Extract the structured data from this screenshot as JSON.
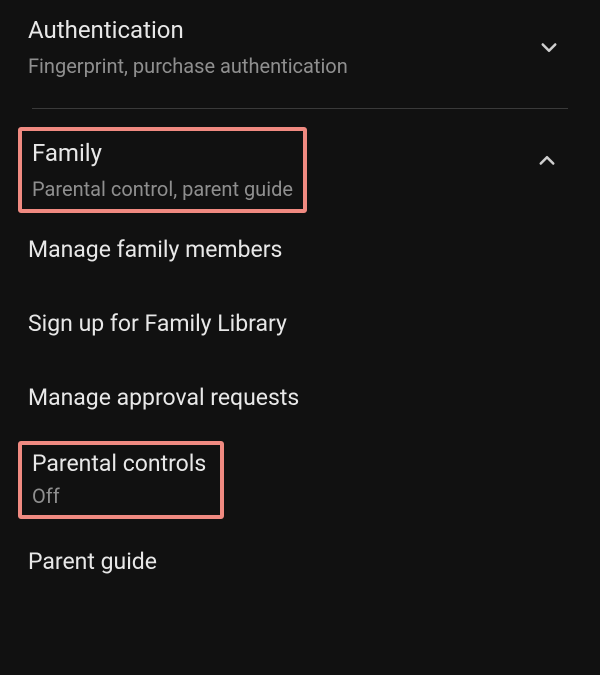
{
  "authentication": {
    "title": "Authentication",
    "subtitle": "Fingerprint, purchase authentication"
  },
  "family": {
    "title": "Family",
    "subtitle": "Parental control, parent guide",
    "items": {
      "manage_members": "Manage family members",
      "signup_library": "Sign up for Family Library",
      "manage_approvals": "Manage approval requests",
      "parental_controls_label": "Parental controls",
      "parental_controls_value": "Off",
      "parent_guide": "Parent guide"
    }
  }
}
